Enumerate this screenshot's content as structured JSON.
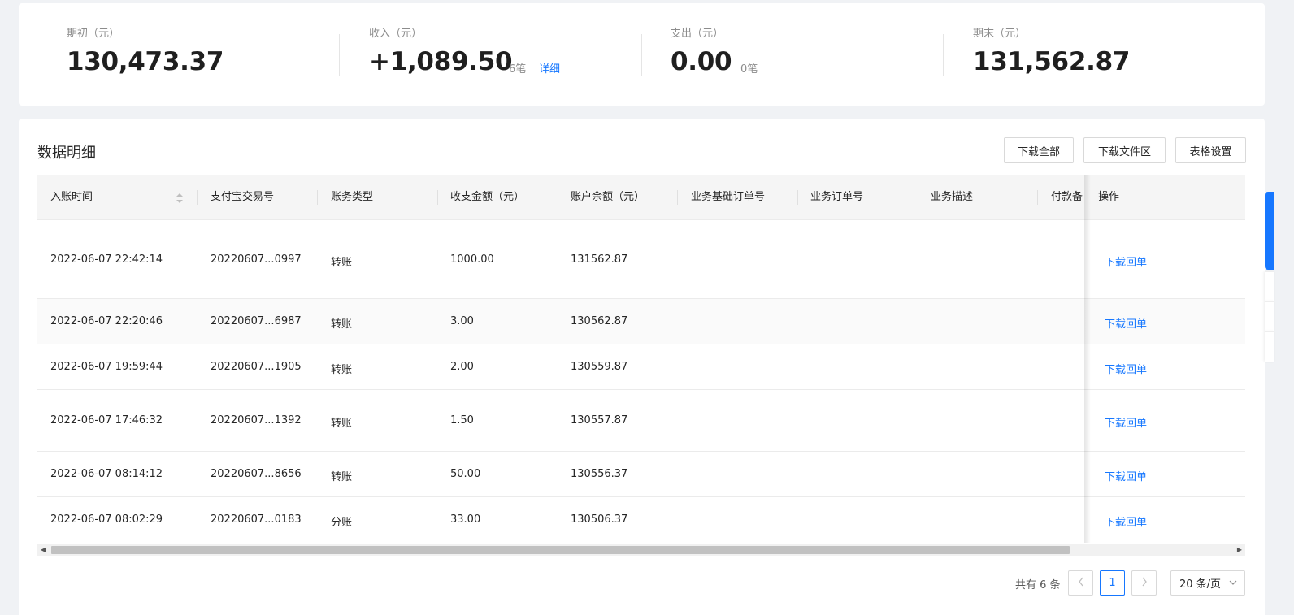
{
  "summary": {
    "opening": {
      "label": "期初（元）",
      "value": "130,473.37"
    },
    "income": {
      "label": "收入（元）",
      "value": "+1,089.50",
      "count": "6笔",
      "detail": "详细"
    },
    "expense": {
      "label": "支出（元）",
      "value": "0.00",
      "count": "0笔"
    },
    "closing": {
      "label": "期末（元）",
      "value": "131,562.87"
    }
  },
  "panel": {
    "title": "数据明细",
    "buttons": {
      "download_all": "下载全部",
      "download_area": "下载文件区",
      "table_settings": "表格设置"
    }
  },
  "table": {
    "columns": [
      "入账时间",
      "支付宝交易号",
      "账务类型",
      "收支金额（元）",
      "账户余额（元）",
      "业务基础订单号",
      "业务订单号",
      "业务描述",
      "付款备",
      "操作"
    ],
    "rows": [
      {
        "time": "2022-06-07 22:42:14",
        "trade_no": "20220607...0997",
        "type": "转账",
        "amount": "1000.00",
        "balance": "131562.87",
        "action": "下载回单"
      },
      {
        "time": "2022-06-07 22:20:46",
        "trade_no": "20220607...6987",
        "type": "转账",
        "amount": "3.00",
        "balance": "130562.87",
        "action": "下载回单"
      },
      {
        "time": "2022-06-07 19:59:44",
        "trade_no": "20220607...1905",
        "type": "转账",
        "amount": "2.00",
        "balance": "130559.87",
        "action": "下载回单"
      },
      {
        "time": "2022-06-07 17:46:32",
        "trade_no": "20220607...1392",
        "type": "转账",
        "amount": "1.50",
        "balance": "130557.87",
        "action": "下载回单"
      },
      {
        "time": "2022-06-07 08:14:12",
        "trade_no": "20220607...8656",
        "type": "转账",
        "amount": "50.00",
        "balance": "130556.37",
        "action": "下载回单"
      },
      {
        "time": "2022-06-07 08:02:29",
        "trade_no": "20220607...0183",
        "type": "分账",
        "amount": "33.00",
        "balance": "130506.37",
        "action": "下载回单"
      }
    ]
  },
  "pagination": {
    "total": "共有 6 条",
    "current_page": "1",
    "prev_icon": "chevron-left-icon",
    "next_icon": "chevron-right-icon",
    "page_size": "20 条/页"
  },
  "colors": {
    "link": "#1677ff",
    "side_tab": "#1677ff"
  }
}
